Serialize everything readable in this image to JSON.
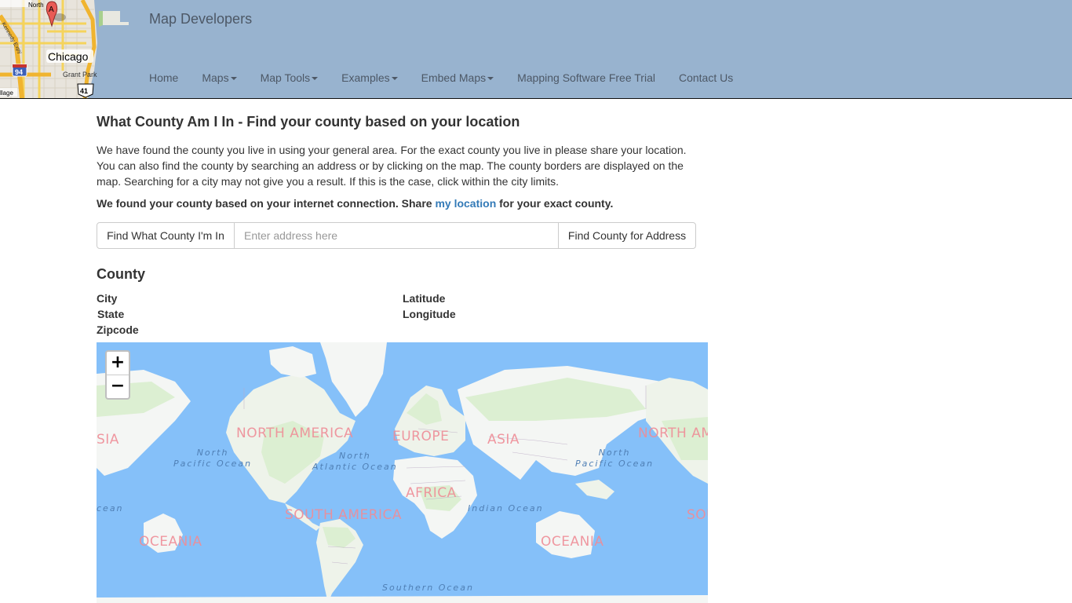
{
  "header": {
    "site_title": "Map Developers",
    "logo_labels": {
      "city": "Chicago",
      "park": "Grant Park",
      "north": "North",
      "highway_interstate": "94",
      "highway_us": "41",
      "marker": "A",
      "village": "llage",
      "expy": "Kennedy Expy"
    },
    "nav": [
      {
        "label": "Home",
        "dropdown": false
      },
      {
        "label": "Maps",
        "dropdown": true
      },
      {
        "label": "Map Tools",
        "dropdown": true
      },
      {
        "label": "Examples",
        "dropdown": true
      },
      {
        "label": "Embed Maps",
        "dropdown": true
      },
      {
        "label": "Mapping Software Free Trial",
        "dropdown": false
      },
      {
        "label": "Contact Us",
        "dropdown": false
      }
    ]
  },
  "main": {
    "title": "What County Am I In - Find your county based on your location",
    "intro": "We have found the county you live in using your general area. For the exact county you live in please share your location. You can also find the county by searching an address or by clicking on the map. The county borders are displayed on the map. Searching for a city may not give you a result. If this is the case, click within the city limits.",
    "found_prefix": "We found your county based on your internet connection. Share ",
    "found_link": "my location",
    "found_suffix": " for your exact county.",
    "find_button": "Find What County I'm In",
    "address_placeholder": "Enter address here",
    "address_value": "",
    "address_button": "Find County for Address",
    "county_heading": "County",
    "fields": {
      "city": "City",
      "state": "State",
      "zipcode": "Zipcode",
      "latitude": "Latitude",
      "longitude": "Longitude"
    }
  },
  "map": {
    "zoom_in": "+",
    "zoom_out": "−",
    "continents": [
      "SIA",
      "NORTH AMERICA",
      "EUROPE",
      "ASIA",
      "NORTH AM",
      "AFRICA",
      "SOUTH AMERICA",
      "OCEANIA",
      "OCEANIA",
      "SOU"
    ],
    "oceans": [
      {
        "line1": "North",
        "line2": "Pacific Ocean"
      },
      {
        "line1": "North",
        "line2": "Atlantic Ocean"
      },
      {
        "line1": "North",
        "line2": "Pacific Ocean"
      },
      {
        "line1": "",
        "line2": "Indian Ocean"
      },
      {
        "line1": "",
        "line2": "cean"
      },
      {
        "line1": "",
        "line2": "Southern Ocean"
      }
    ],
    "colors": {
      "water": "#85c0f9",
      "land": "#f4f6f4",
      "vegetation": "#dcefd2",
      "continent_label": "#ef8d97",
      "ocean_label": "#4f7fb5"
    }
  }
}
